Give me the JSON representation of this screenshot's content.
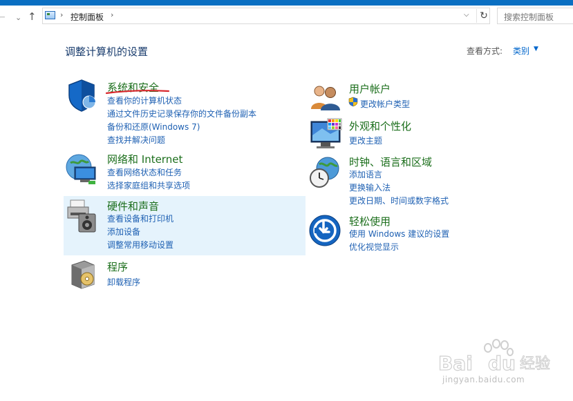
{
  "nav": {
    "back": "←",
    "forward": "→",
    "dropdown": "⌄",
    "up": "↑"
  },
  "address": {
    "separator": "›",
    "crumb": "控制面板",
    "dropdown": "⌵",
    "refresh": "↻"
  },
  "search": {
    "placeholder": "搜索控制面板"
  },
  "page_title": "调整计算机的设置",
  "view_by": {
    "label": "查看方式:",
    "value": "类别",
    "arrow": "▼"
  },
  "categories": [
    {
      "title": "系统和安全",
      "links": [
        "查看你的计算机状态",
        "通过文件历史记录保存你的文件备份副本",
        "备份和还原(Windows 7)",
        "查找并解决问题"
      ],
      "icon": "shield-icon"
    },
    {
      "title": "网络和 Internet",
      "links": [
        "查看网络状态和任务",
        "选择家庭组和共享选项"
      ],
      "icon": "network-globe-icon"
    },
    {
      "title": "硬件和声音",
      "links": [
        "查看设备和打印机",
        "添加设备",
        "调整常用移动设置"
      ],
      "icon": "printer-speaker-icon"
    },
    {
      "title": "程序",
      "links": [
        "卸载程序"
      ],
      "icon": "programs-disc-icon"
    },
    {
      "title": "用户帐户",
      "links": [
        "更改帐户类型"
      ],
      "icon": "users-icon"
    },
    {
      "title": "外观和个性化",
      "links": [
        "更改主题"
      ],
      "icon": "monitor-palette-icon"
    },
    {
      "title": "时钟、语言和区域",
      "links": [
        "添加语言",
        "更换输入法",
        "更改日期、时间或数字格式"
      ],
      "icon": "clock-globe-icon"
    },
    {
      "title": "轻松使用",
      "links": [
        "使用 Windows 建议的设置",
        "优化视觉显示"
      ],
      "icon": "ease-of-access-icon"
    }
  ],
  "watermark": {
    "url": "jingyan.baidu.com",
    "brand": "Bai",
    "brand2": "du",
    "brand3": "经验"
  },
  "colors": {
    "title_bar": "#0a6fc2",
    "category_title": "#1b6e1b",
    "link": "#1f61b3",
    "highlight": "#e5f3fc"
  }
}
